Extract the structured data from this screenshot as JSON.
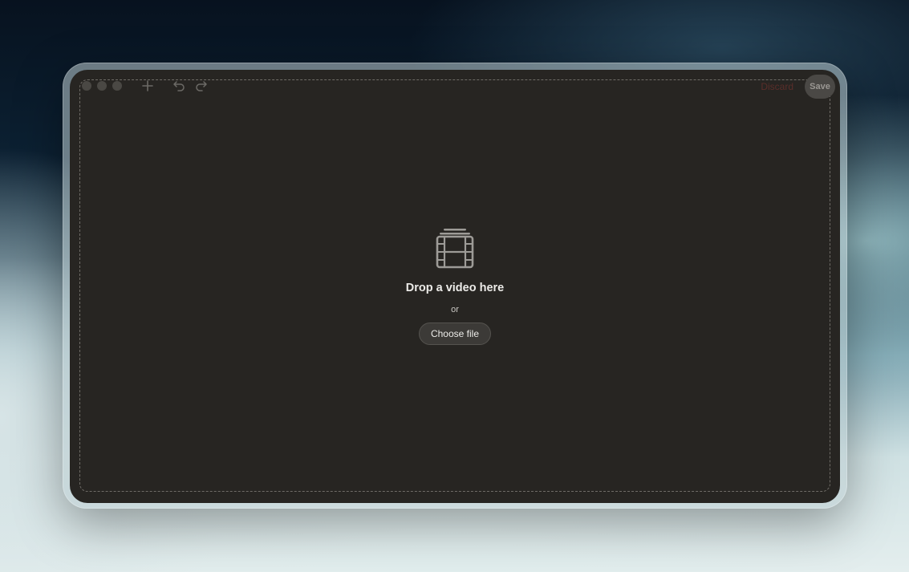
{
  "toolbar": {
    "traffic_lights": [
      "close",
      "minimize",
      "zoom"
    ],
    "add_icon": "plus-icon",
    "undo_icon": "undo-icon",
    "redo_icon": "redo-icon",
    "discard_label": "Discard",
    "save_label": "Save"
  },
  "drop_zone": {
    "icon": "film-strip-icon",
    "title": "Drop a video here",
    "separator": "or",
    "choose_label": "Choose file"
  },
  "colors": {
    "window_bg": "#272522",
    "dashed_border": "#6f6c67",
    "text_primary": "#ecebe8",
    "button_bg": "#3c3a37",
    "discard_text": "#5a2e2a"
  }
}
